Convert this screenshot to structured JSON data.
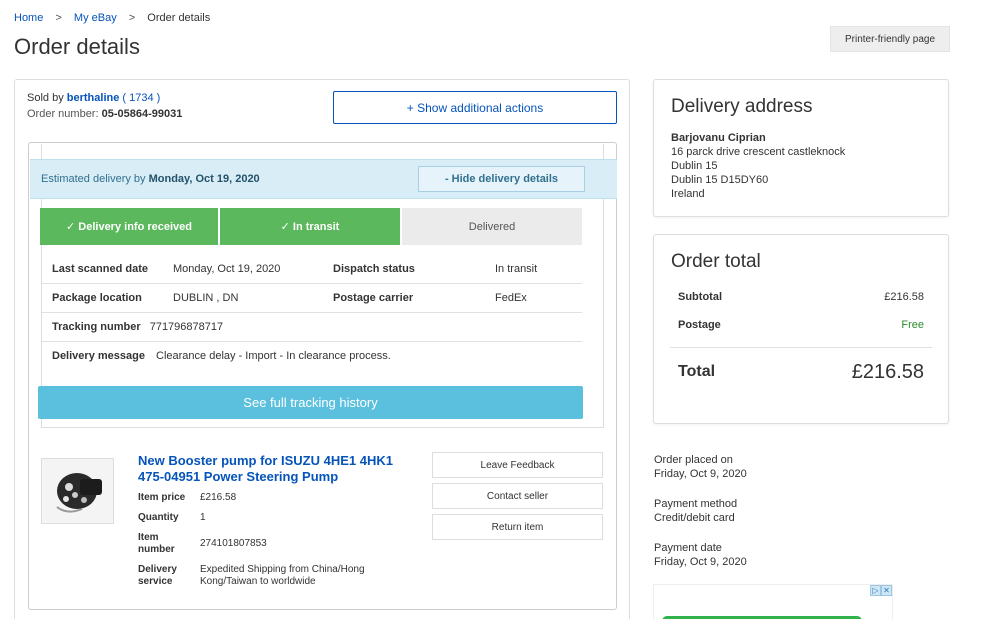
{
  "breadcrumb": {
    "home": "Home",
    "my_ebay": "My eBay",
    "current": "Order details",
    "sep": ">"
  },
  "page_title": "Order details",
  "printer_button": "Printer-friendly page",
  "order": {
    "sold_by_label": "Sold by",
    "seller_name": "berthaline",
    "seller_score": "( 1734 )",
    "order_number_label": "Order number:",
    "order_number": "05-05864-99031",
    "show_actions": "+ Show additional actions"
  },
  "delivery": {
    "estimated_label": "Estimated delivery by",
    "estimated_date": "Monday, Oct 19, 2020",
    "hide_details": "- Hide delivery details",
    "steps": [
      "✓ Delivery info received",
      "✓ In transit",
      "Delivered"
    ],
    "last_scanned_label": "Last scanned date",
    "last_scanned_value": "Monday, Oct 19, 2020",
    "dispatch_status_label": "Dispatch status",
    "dispatch_status_value": "In transit",
    "package_location_label": "Package location",
    "package_location_value": "DUBLIN , DN",
    "postage_carrier_label": "Postage carrier",
    "postage_carrier_value": "FedEx",
    "tracking_number_label": "Tracking number",
    "tracking_number_value": "771796878717",
    "delivery_message_label": "Delivery message",
    "delivery_message_value": "Clearance delay - Import - In clearance process.",
    "tracking_button": "See full tracking history"
  },
  "item": {
    "title": "New Booster pump for ISUZU 4HE1 4HK1 475-04951 Power Steering Pump",
    "price_label": "Item price",
    "price_value": "£216.58",
    "quantity_label": "Quantity",
    "quantity_value": "1",
    "item_number_label": "Item number",
    "item_number_value": "274101807853",
    "delivery_service_label": "Delivery service",
    "delivery_service_value": "Expedited Shipping from China/Hong Kong/Taiwan to worldwide",
    "actions": [
      "Leave Feedback",
      "Contact seller",
      "Return item"
    ]
  },
  "delivery_address": {
    "title": "Delivery address",
    "name": "Barjovanu Ciprian",
    "lines": [
      "16 parck drive crescent castleknock",
      "Dublin 15",
      "Dublin 15 D15DY60",
      "Ireland"
    ]
  },
  "order_total": {
    "title": "Order total",
    "subtotal_label": "Subtotal",
    "subtotal_value": "£216.58",
    "postage_label": "Postage",
    "postage_value": "Free",
    "total_label": "Total",
    "total_value": "£216.58"
  },
  "meta": {
    "order_placed_label": "Order placed on",
    "order_placed_value": "Friday, Oct 9, 2020",
    "payment_method_label": "Payment method",
    "payment_method_value": "Credit/debit card",
    "payment_date_label": "Payment date",
    "payment_date_value": "Friday, Oct 9, 2020"
  },
  "colors": {
    "link": "#0654ba",
    "step_done": "#5cb85c",
    "info_bg": "#d9edf7",
    "tracking_button": "#5bc0de",
    "free": "#2e8b2e"
  }
}
